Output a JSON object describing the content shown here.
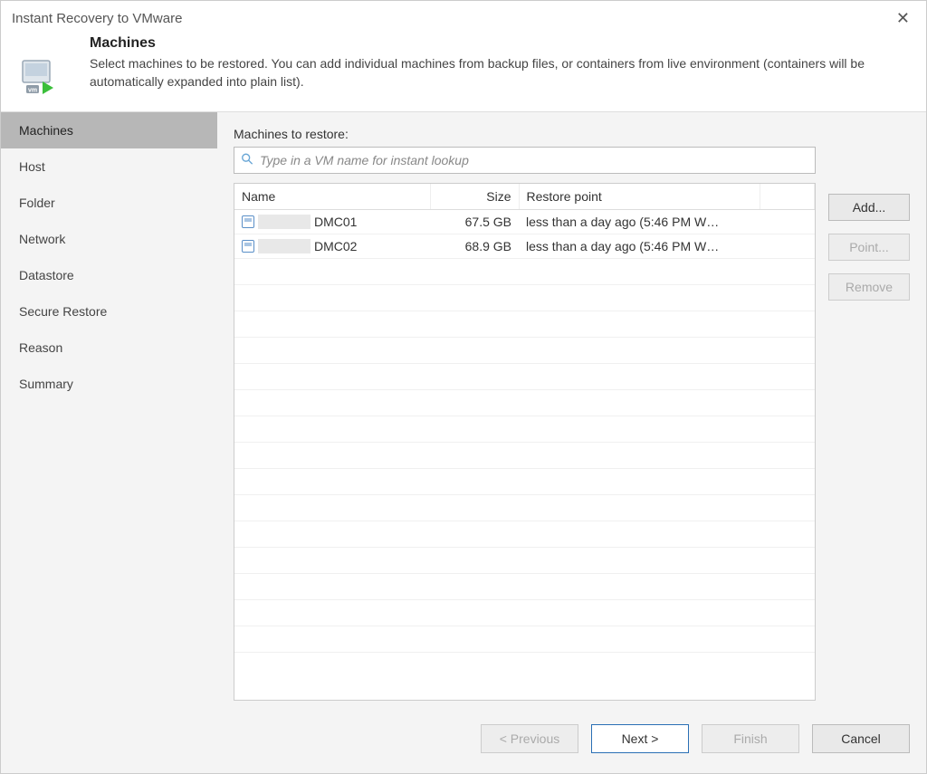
{
  "window": {
    "title": "Instant Recovery to VMware"
  },
  "header": {
    "heading": "Machines",
    "description": "Select machines to be restored. You can add individual machines from backup files, or containers from live environment (containers will be automatically expanded into plain list)."
  },
  "sidebar": {
    "items": [
      {
        "label": "Machines"
      },
      {
        "label": "Host"
      },
      {
        "label": "Folder"
      },
      {
        "label": "Network"
      },
      {
        "label": "Datastore"
      },
      {
        "label": "Secure Restore"
      },
      {
        "label": "Reason"
      },
      {
        "label": "Summary"
      }
    ],
    "active_index": 0
  },
  "main": {
    "list_label": "Machines to restore:",
    "search": {
      "placeholder": "Type in a VM name for instant lookup"
    },
    "columns": {
      "name": "Name",
      "size": "Size",
      "restore_point": "Restore point"
    },
    "rows": [
      {
        "name": "DMC01",
        "size": "67.5 GB",
        "restore_point": "less than a day ago (5:46 PM W…"
      },
      {
        "name": "DMC02",
        "size": "68.9 GB",
        "restore_point": "less than a day ago (5:46 PM W…"
      }
    ],
    "buttons": {
      "add": "Add...",
      "point": "Point...",
      "remove": "Remove"
    }
  },
  "footer": {
    "previous": "< Previous",
    "next": "Next >",
    "finish": "Finish",
    "cancel": "Cancel"
  }
}
